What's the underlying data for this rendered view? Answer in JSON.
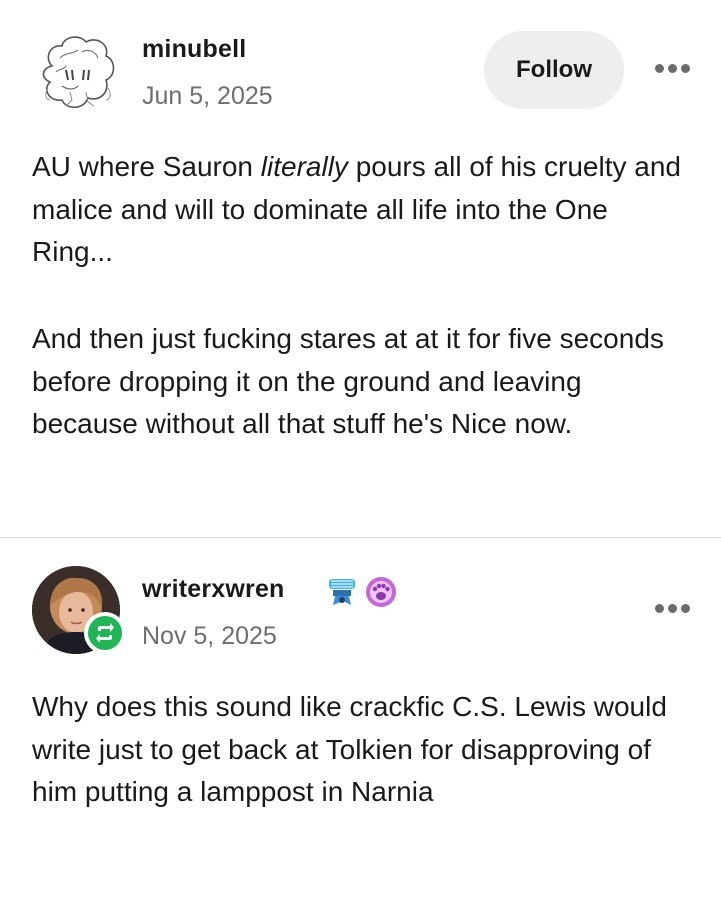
{
  "post": {
    "username": "minubell",
    "date": "Jun 5, 2025",
    "follow_label": "Follow",
    "paragraph1": {
      "before": "AU where Sauron ",
      "emphasis": "literally",
      "after": " pours all of his cruelty and malice and will to dominate all life into the One Ring..."
    },
    "paragraph2": "And then just fucking stares at at it for five seconds before dropping it on the ground and leaving because without all that stuff he's Nice now."
  },
  "reblog": {
    "username": "writerxwren",
    "date": "Nov 5, 2025",
    "badges": [
      "blue-bird-badge-icon",
      "paw-print-badge-icon"
    ],
    "reblog_icon": "reblog-icon",
    "text": "Why does this sound like crackfic C.S. Lewis would write just to get back at Tolkien for disapproving of him putting a lamppost in Narnia"
  },
  "colors": {
    "background": "#ffffff",
    "text": "#1a1a1a",
    "secondary_text": "#6e6e6e",
    "follow_button_bg": "#eeeeee",
    "reblog_green": "#1fb656",
    "divider": "#dcdcdc"
  },
  "icons": {
    "more_menu": "more-horizontal-icon"
  }
}
